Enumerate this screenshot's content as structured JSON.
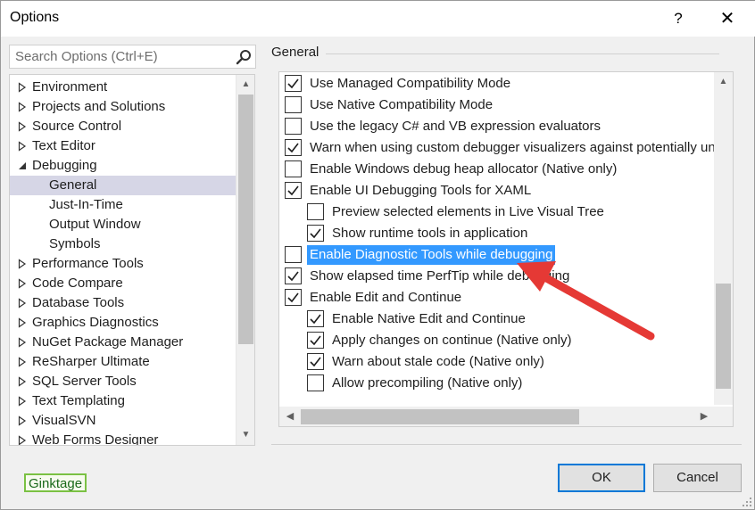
{
  "window": {
    "title": "Options",
    "help_label": "?",
    "close_label": "✕"
  },
  "search": {
    "placeholder": "Search Options (Ctrl+E)",
    "icon": "search-icon"
  },
  "tree": {
    "items": [
      {
        "label": "Environment",
        "expanded": false,
        "level": 0,
        "selected": false
      },
      {
        "label": "Projects and Solutions",
        "expanded": false,
        "level": 0,
        "selected": false
      },
      {
        "label": "Source Control",
        "expanded": false,
        "level": 0,
        "selected": false
      },
      {
        "label": "Text Editor",
        "expanded": false,
        "level": 0,
        "selected": false
      },
      {
        "label": "Debugging",
        "expanded": true,
        "level": 0,
        "selected": false
      },
      {
        "label": "General",
        "level": 1,
        "selected": true
      },
      {
        "label": "Just-In-Time",
        "level": 1,
        "selected": false
      },
      {
        "label": "Output Window",
        "level": 1,
        "selected": false
      },
      {
        "label": "Symbols",
        "level": 1,
        "selected": false
      },
      {
        "label": "Performance Tools",
        "expanded": false,
        "level": 0,
        "selected": false
      },
      {
        "label": "Code Compare",
        "expanded": false,
        "level": 0,
        "selected": false
      },
      {
        "label": "Database Tools",
        "expanded": false,
        "level": 0,
        "selected": false
      },
      {
        "label": "Graphics Diagnostics",
        "expanded": false,
        "level": 0,
        "selected": false
      },
      {
        "label": "NuGet Package Manager",
        "expanded": false,
        "level": 0,
        "selected": false
      },
      {
        "label": "ReSharper Ultimate",
        "expanded": false,
        "level": 0,
        "selected": false
      },
      {
        "label": "SQL Server Tools",
        "expanded": false,
        "level": 0,
        "selected": false
      },
      {
        "label": "Text Templating",
        "expanded": false,
        "level": 0,
        "selected": false
      },
      {
        "label": "VisualSVN",
        "expanded": false,
        "level": 0,
        "selected": false
      },
      {
        "label": "Web Forms Designer",
        "expanded": false,
        "level": 0,
        "selected": false
      }
    ]
  },
  "group": {
    "label": "General"
  },
  "options": [
    {
      "label": "Use Managed Compatibility Mode",
      "checked": true,
      "indent": 0,
      "highlighted": false
    },
    {
      "label": "Use Native Compatibility Mode",
      "checked": false,
      "indent": 0,
      "highlighted": false
    },
    {
      "label": "Use the legacy C# and VB expression evaluators",
      "checked": false,
      "indent": 0,
      "highlighted": false
    },
    {
      "label": "Warn when using custom debugger visualizers against potentially uns",
      "checked": true,
      "indent": 0,
      "highlighted": false
    },
    {
      "label": "Enable Windows debug heap allocator (Native only)",
      "checked": false,
      "indent": 0,
      "highlighted": false
    },
    {
      "label": "Enable UI Debugging Tools for XAML",
      "checked": true,
      "indent": 0,
      "highlighted": false
    },
    {
      "label": "Preview selected elements in Live Visual Tree",
      "checked": false,
      "indent": 1,
      "highlighted": false
    },
    {
      "label": "Show runtime tools in application",
      "checked": true,
      "indent": 1,
      "highlighted": false
    },
    {
      "label": "Enable Diagnostic Tools while debugging",
      "checked": false,
      "indent": 0,
      "highlighted": true
    },
    {
      "label": "Show elapsed time PerfTip while debugging",
      "checked": true,
      "indent": 0,
      "highlighted": false
    },
    {
      "label": "Enable Edit and Continue",
      "checked": true,
      "indent": 0,
      "highlighted": false
    },
    {
      "label": "Enable Native Edit and Continue",
      "checked": true,
      "indent": 1,
      "highlighted": false
    },
    {
      "label": "Apply changes on continue (Native only)",
      "checked": true,
      "indent": 1,
      "highlighted": false
    },
    {
      "label": "Warn about stale code (Native only)",
      "checked": true,
      "indent": 1,
      "highlighted": false
    },
    {
      "label": "Allow precompiling (Native only)",
      "checked": false,
      "indent": 1,
      "highlighted": false
    }
  ],
  "buttons": {
    "ok": "OK",
    "cancel": "Cancel"
  },
  "watermark": "Ginktage",
  "colors": {
    "selection": "#3399ff",
    "tree_selected": "#d6d6e6",
    "annotation_arrow": "#e53935",
    "ok_border": "#0078d7",
    "watermark_border": "#7ac143"
  }
}
